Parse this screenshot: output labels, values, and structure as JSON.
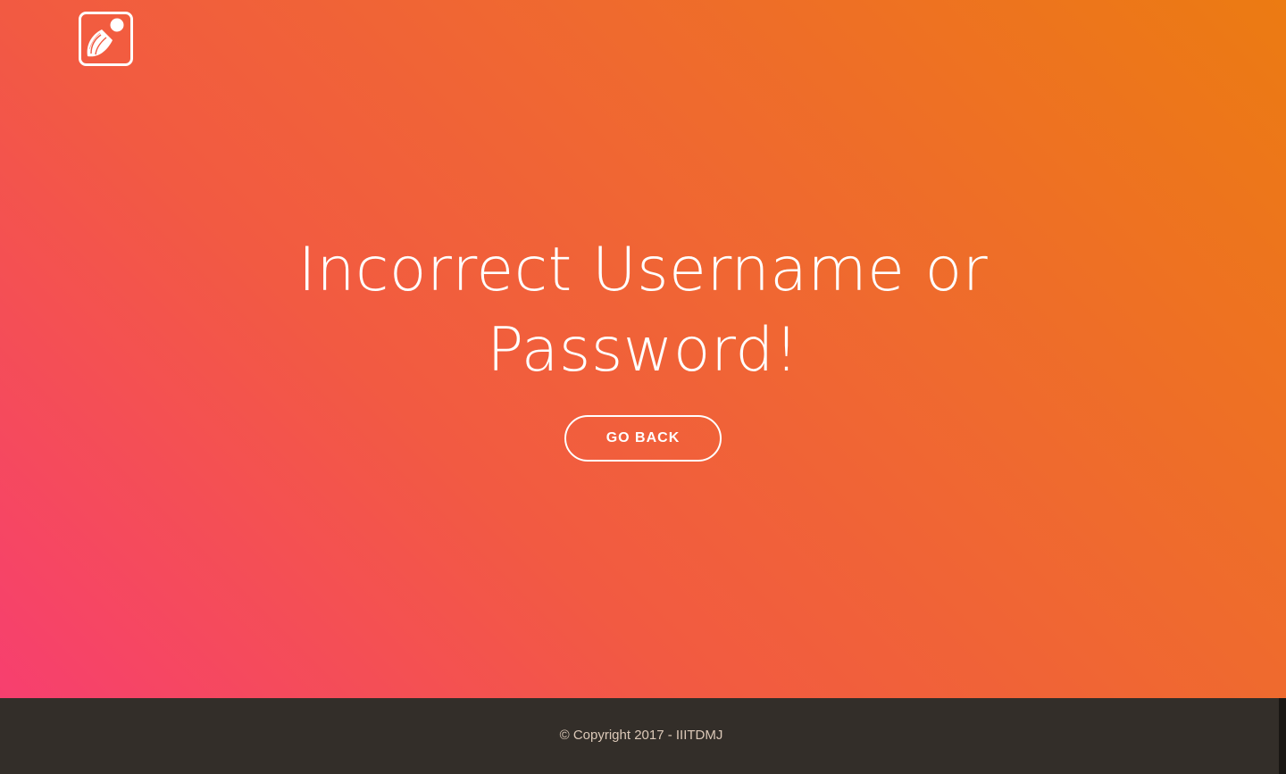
{
  "brand": {
    "logo_icon": "shuttlecock-icon",
    "colors": {
      "gradient_start": "#f73f6f",
      "gradient_end": "#ec7b12",
      "footer_bg": "#332e29",
      "footer_text": "#dcc9b8"
    }
  },
  "message": {
    "line1": "Incorrect Username or",
    "line2": "Password!"
  },
  "actions": {
    "back_label": "GO BACK"
  },
  "footer": {
    "copyright": "© Copyright 2017 - IIITDMJ"
  }
}
